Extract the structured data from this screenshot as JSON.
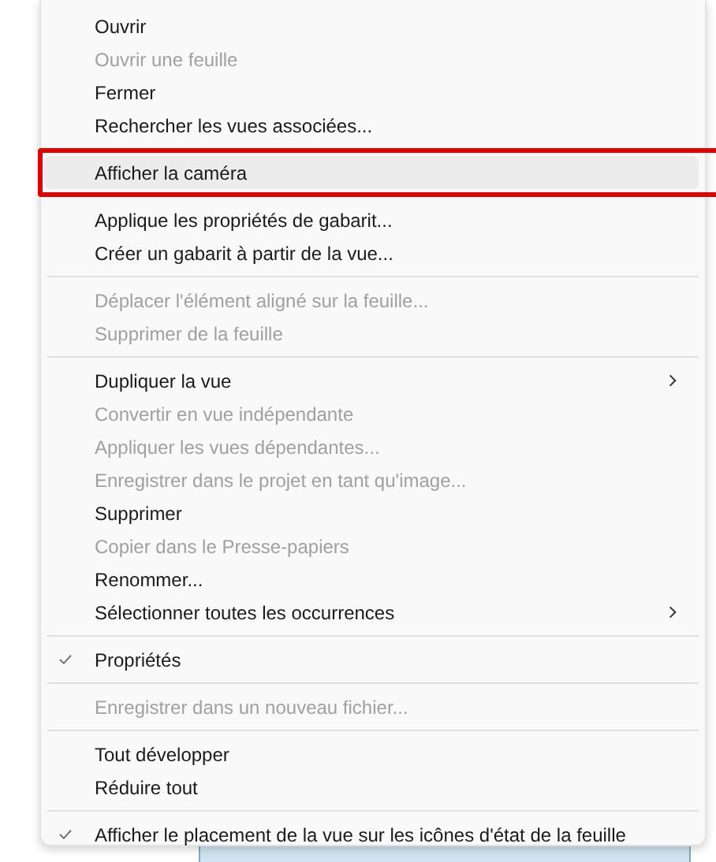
{
  "menu": {
    "groups": [
      {
        "items": [
          {
            "label": "Ouvrir",
            "disabled": false,
            "checked": false,
            "submenu": false,
            "highlighted": false
          },
          {
            "label": "Ouvrir une feuille",
            "disabled": true,
            "checked": false,
            "submenu": false,
            "highlighted": false
          },
          {
            "label": "Fermer",
            "disabled": false,
            "checked": false,
            "submenu": false,
            "highlighted": false
          },
          {
            "label": "Rechercher les vues associées...",
            "disabled": false,
            "checked": false,
            "submenu": false,
            "highlighted": false
          }
        ]
      },
      {
        "items": [
          {
            "label": "Afficher la caméra",
            "disabled": false,
            "checked": false,
            "submenu": false,
            "highlighted": true
          }
        ]
      },
      {
        "items": [
          {
            "label": "Applique les propriétés de gabarit...",
            "disabled": false,
            "checked": false,
            "submenu": false,
            "highlighted": false
          },
          {
            "label": "Créer un gabarit à partir de la vue...",
            "disabled": false,
            "checked": false,
            "submenu": false,
            "highlighted": false
          }
        ]
      },
      {
        "items": [
          {
            "label": "Déplacer l'élément aligné sur la feuille...",
            "disabled": true,
            "checked": false,
            "submenu": false,
            "highlighted": false
          },
          {
            "label": "Supprimer de la feuille",
            "disabled": true,
            "checked": false,
            "submenu": false,
            "highlighted": false
          }
        ]
      },
      {
        "items": [
          {
            "label": "Dupliquer la vue",
            "disabled": false,
            "checked": false,
            "submenu": true,
            "highlighted": false
          },
          {
            "label": "Convertir en vue indépendante",
            "disabled": true,
            "checked": false,
            "submenu": false,
            "highlighted": false
          },
          {
            "label": "Appliquer les vues dépendantes...",
            "disabled": true,
            "checked": false,
            "submenu": false,
            "highlighted": false
          },
          {
            "label": "Enregistrer dans le projet en tant qu'image...",
            "disabled": true,
            "checked": false,
            "submenu": false,
            "highlighted": false
          },
          {
            "label": "Supprimer",
            "disabled": false,
            "checked": false,
            "submenu": false,
            "highlighted": false
          },
          {
            "label": "Copier dans le Presse-papiers",
            "disabled": true,
            "checked": false,
            "submenu": false,
            "highlighted": false
          },
          {
            "label": "Renommer...",
            "disabled": false,
            "checked": false,
            "submenu": false,
            "highlighted": false
          },
          {
            "label": "Sélectionner toutes les occurrences",
            "disabled": false,
            "checked": false,
            "submenu": true,
            "highlighted": false
          }
        ]
      },
      {
        "items": [
          {
            "label": "Propriétés",
            "disabled": false,
            "checked": true,
            "submenu": false,
            "highlighted": false
          }
        ]
      },
      {
        "items": [
          {
            "label": "Enregistrer dans un nouveau fichier...",
            "disabled": true,
            "checked": false,
            "submenu": false,
            "highlighted": false
          }
        ]
      },
      {
        "items": [
          {
            "label": "Tout développer",
            "disabled": false,
            "checked": false,
            "submenu": false,
            "highlighted": false
          },
          {
            "label": "Réduire tout",
            "disabled": false,
            "checked": false,
            "submenu": false,
            "highlighted": false
          }
        ]
      },
      {
        "items": [
          {
            "label": "Afficher le placement de la vue sur les icônes d'état de la feuille",
            "disabled": false,
            "checked": true,
            "submenu": false,
            "highlighted": false
          }
        ]
      }
    ]
  }
}
